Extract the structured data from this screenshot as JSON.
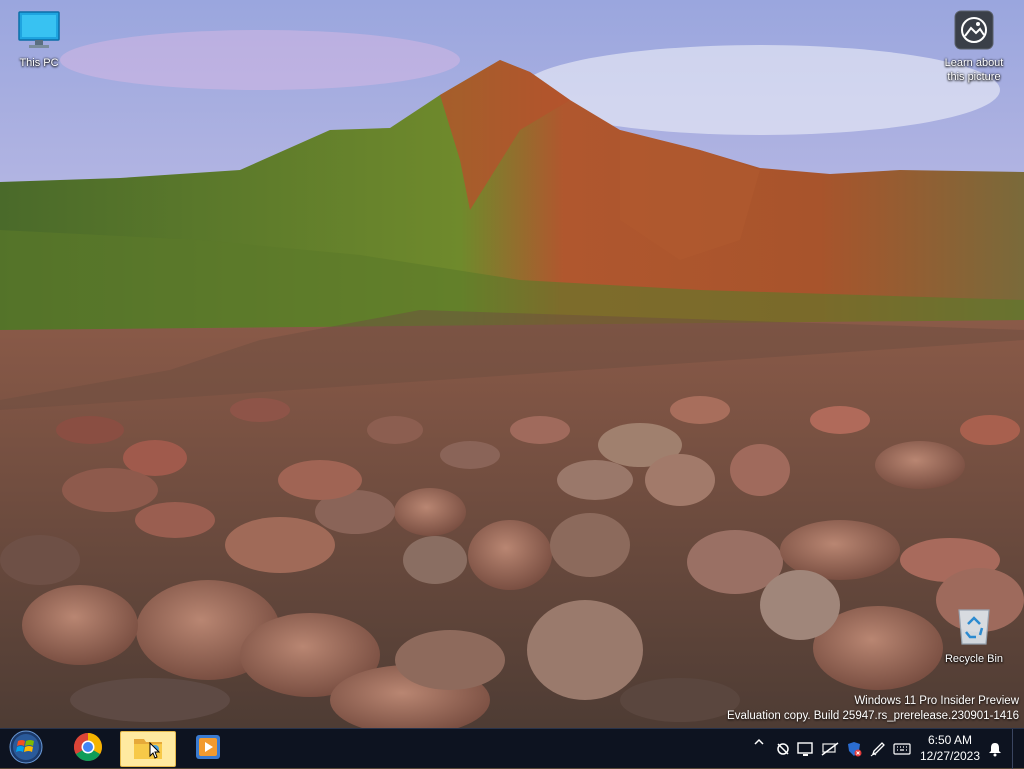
{
  "desktop": {
    "icons": {
      "this_pc": "This PC",
      "learn_about": "Learn about this picture",
      "recycle_bin": "Recycle Bin"
    },
    "watermark": {
      "line1": "Windows 11 Pro Insider Preview",
      "line2": "Evaluation copy. Build 25947.rs_prerelease.230901-1416"
    }
  },
  "taskbar": {
    "apps": [
      {
        "name": "start-button",
        "icon": "windows-logo-icon"
      },
      {
        "name": "chrome",
        "icon": "chrome-icon"
      },
      {
        "name": "file-explorer",
        "icon": "folder-icon",
        "active": true
      },
      {
        "name": "media-player",
        "icon": "media-player-icon"
      }
    ],
    "tray": {
      "icons": [
        "chevron-up-icon",
        "settings-disabled-icon",
        "display-icon",
        "network-icon",
        "security-icon",
        "pen-icon",
        "keyboard-icon"
      ]
    },
    "clock": {
      "time": "6:50 AM",
      "date": "12/27/2023"
    },
    "notification_icon": "bell-icon"
  },
  "colors": {
    "taskbar_bg": "#0d1320",
    "active_app_bg": "#ffeaa0",
    "accent": "#1e88e5"
  }
}
